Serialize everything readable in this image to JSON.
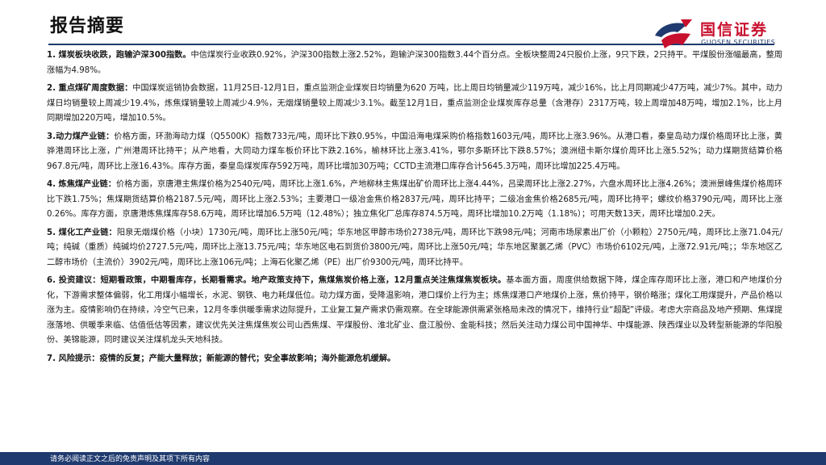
{
  "header": {
    "title": "报告摘要",
    "brand_cn": "国信证券",
    "brand_en": "GUOSEN SECURITIES"
  },
  "paragraphs": [
    {
      "head": "1. 煤炭板块收跌，跑输沪深300指数。",
      "body": "中信煤炭行业收跌0.92%，沪深300指数上涨2.52%，跑输沪深300指数3.44个百分点。全板块整周24只股价上涨，9只下跌，2只持平。平煤股份涨幅最高，整周涨幅为4.98%。"
    },
    {
      "head": "2. 重点煤矿周度数据：",
      "body": "中国煤炭运销协会数据，11月25日-12月1日，重点监测企业煤炭日均销量为620 万吨，比上周日均销量减少119万吨，减少16%，比上月同期减少47万吨，减少7%。其中，动力煤日均销量较上周减少19.4%，炼焦煤销量较上周减少4.9%，无烟煤销量较上周减少3.1%。截至12月1日，重点监测企业煤炭库存总量（含港存）2317万吨，较上周增加48万吨，增加2.1%，比上月同期增加220万吨，增加10.5%。"
    },
    {
      "head": "3.动力煤产业链：",
      "body": "价格方面，环渤海动力煤（Q5500K）指数733元/吨，周环比下跌0.95%，中国沿海电煤采购价格指数1603元/吨，周环比上涨3.96%。从港口看，秦皇岛动力煤价格周环比上涨，黄骅港周环比上涨，广州港周环比持平；从产地看，大同动力煤车板价环比下跌2.16%，榆林环比上涨3.41%，鄂尔多斯环比下跌8.57%；澳洲纽卡斯尔煤价周环比上涨5.52%；动力煤期货结算价格967.8元/吨，周环比上涨16.43%。库存方面，秦皇岛煤炭库存592万吨，周环比增加30万吨；CCTD主流港口库存合计5645.3万吨，周环比增加225.4万吨。"
    },
    {
      "head": "4. 炼焦煤产业链：",
      "body": "价格方面，京唐港主焦煤价格为2540元/吨，周环比上涨1.6%，产地柳林主焦煤出矿价周环比上涨4.44%，吕梁周环比上涨2.27%，六盘水周环比上涨4.26%；澳洲景峰焦煤价格周环比下跌1.75%；焦煤期货结算价格2187.5元/吨，周环比上涨2.53%；主要港口一级冶金焦价格2837元/吨，周环比持平；二级冶金焦价格2685元/吨，周环比持平；螺纹价格3790元/吨，周环比上涨0.26%。库存方面，京唐港炼焦煤库存58.6万吨，周环比增加6.5万吨（12.48%）；独立焦化厂总库存874.5万吨，周环比增加10.2万吨（1.18%）；可用天数13天，周环比增加0.2天。"
    },
    {
      "head": "5. 煤化工产业链：",
      "body": "阳泉无烟煤价格（小块）1730元/吨，周环比上涨50元/吨；华东地区甲醇市场价2738元/吨，周环比下跌98元/吨；河南市场尿素出厂价（小颗粒）2750元/吨，周环比上涨71.04元/吨；纯碱（重质）纯碱均价2727.5元/吨，周环比上涨13.75元/吨；华东地区电石到货价3800元/吨，周环比上涨50元/吨；华东地区聚氯乙烯（PVC）市场价6102元/吨，上涨72.91元/吨；；华东地区乙二醇市场价（主流价）3902元/吨，周环比上涨106元/吨；上海石化聚乙烯（PE）出厂价9300元/吨，周环比持平。"
    },
    {
      "head": "6. 投资建议：短期看政策，中期看库存，长期看需求。地产政策支持下，焦煤焦炭价格上涨，12月重点关注焦煤焦炭板块。",
      "body": "基本面方面，周度供给数据下降，煤企库存周环比上涨，港口和产地煤价分化，下游需求整体偏弱，化工用煤小幅增长，水泥、钢铁、电力耗煤低位。动力煤方面，受降温影响，港口煤价上行为主；炼焦煤港口产地煤价上涨，焦价持平，钢价略涨；煤化工用煤提升，产品价格以涨为主。疫情影响仍在持续，冷空气已来，12月冬季供暖季需求边际提升，工业复工复产需求仍需观察。在全球能源供需紧张格局未改的情况下，维持行业“超配”评级。考虑大宗商品及地产预期、焦煤提涨落地、供暖季来临、估值低估等因素，建议优先关注焦煤焦炭公司山西焦煤、平煤股份、淮北矿业、盘江股份、金能科技；然后关注动力煤公司中国神华、中煤能源、陕西煤业以及转型新能源的华阳股份、美锦能源，同时建议关注煤机龙头天地科技。"
    },
    {
      "head": "7. 风险提示：疫情的反复；产能大量释放；新能源的替代；安全事故影响；海外能源危机缓解。",
      "body": ""
    }
  ],
  "footer": {
    "disclaimer": "请务必阅读正文之后的免责声明及其项下所有内容"
  },
  "colors": {
    "brand_red": "#c8102e",
    "brand_navy": "#1f3a6e"
  },
  "icons": {
    "logo": "guosen-logo-mark"
  }
}
